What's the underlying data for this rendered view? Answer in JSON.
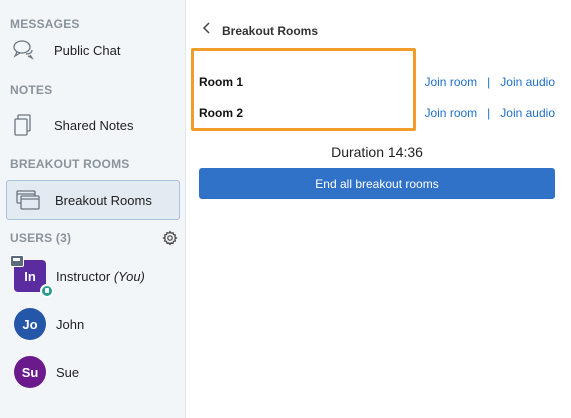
{
  "sidebar": {
    "messages_title": "MESSAGES",
    "public_chat": "Public Chat",
    "notes_title": "NOTES",
    "shared_notes": "Shared Notes",
    "breakout_title": "BREAKOUT ROOMS",
    "breakout_rooms": "Breakout Rooms",
    "users_title": "USERS (3)",
    "users": [
      {
        "initials": "In",
        "name": "Instructor",
        "suffix": "(You)",
        "color": "#5b2ca0"
      },
      {
        "initials": "Jo",
        "name": "John",
        "color": "#2457a8"
      },
      {
        "initials": "Su",
        "name": "Sue",
        "color": "#6b1a8c"
      }
    ]
  },
  "panel": {
    "title": "Breakout Rooms",
    "rooms": [
      {
        "name": "Room 1",
        "join_room": "Join room",
        "separator": "|",
        "join_audio": "Join audio"
      },
      {
        "name": "Room 2",
        "join_room": "Join room",
        "separator": "|",
        "join_audio": "Join audio"
      }
    ],
    "duration": "Duration 14:36",
    "end_all": "End all breakout rooms"
  },
  "colors": {
    "accent": "#2f72c8",
    "highlight": "#f29c2b",
    "link": "#1f6fc5"
  }
}
